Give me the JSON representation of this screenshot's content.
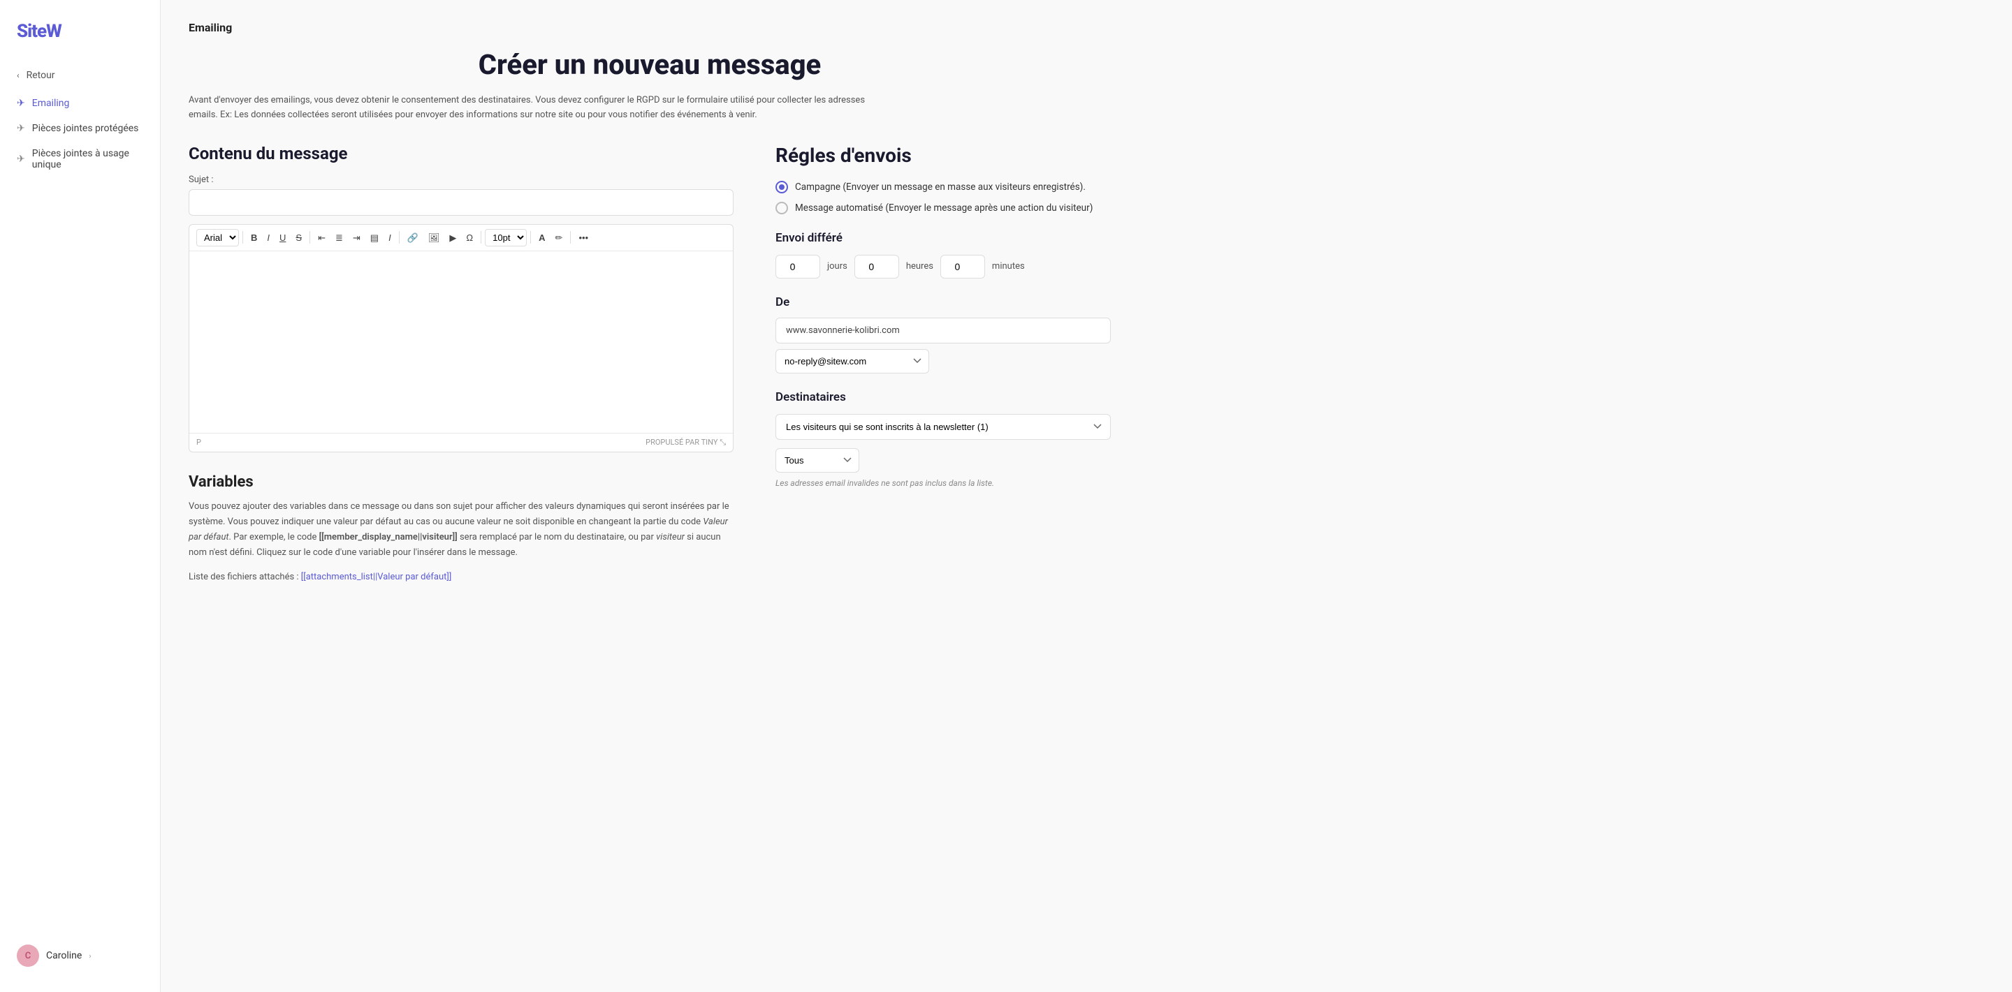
{
  "brand": {
    "logo_text_main": "Site",
    "logo_text_accent": "W"
  },
  "sidebar": {
    "back_label": "Retour",
    "nav_items": [
      {
        "id": "emailing",
        "label": "Emailing",
        "active": true
      },
      {
        "id": "pieces-jointes-protegees",
        "label": "Pièces jointes protégées",
        "active": false
      },
      {
        "id": "pieces-jointes-usage-unique",
        "label": "Pièces jointes à usage unique",
        "active": false
      }
    ],
    "user": {
      "name": "Caroline",
      "avatar_initials": "C"
    }
  },
  "header": {
    "section_title": "Emailing",
    "page_title": "Créer un nouveau message",
    "description": "Avant d'envoyer des emailings, vous devez obtenir le consentement des destinataires. Vous devez configurer le RGPD sur le formulaire utilisé pour collecter les adresses emails. Ex: Les données collectées seront utilisées pour envoyer des informations sur notre site ou pour vous notifier des événements à venir."
  },
  "content": {
    "section_title": "Contenu du message",
    "subject_label": "Sujet :",
    "subject_placeholder": "",
    "toolbar": {
      "font_family": "Arial",
      "font_size": "10pt",
      "bold": "B",
      "italic": "I",
      "underline": "U",
      "strikethrough": "S",
      "align_left": "≡",
      "align_center": "≡",
      "align_right": "≡",
      "justify": "≡",
      "italic2": "I",
      "more": "..."
    },
    "editor_footer_left": "P",
    "editor_footer_right": "PROPULSÉ PAR TINY"
  },
  "variables": {
    "section_title": "Variables",
    "description_parts": {
      "text1": "Vous pouvez ajouter des variables dans ce message ou dans son sujet pour afficher des valeurs dynamiques qui seront insérées par le système. Vous pouvez indiquer une valeur par défaut au cas ou aucune valeur ne soit disponible en changeant la partie du code ",
      "italic": "Valeur par défaut",
      "text2": ". Par exemple, le code ",
      "code": "[[member_display_name||visiteur]]",
      "text3": " sera remplacé par le nom du destinataire, ou par ",
      "italic2": "visiteur",
      "text4": " si aucun nom n'est défini. Cliquez sur le code d'une variable pour l'insérer dans le message."
    },
    "attachments_label": "Liste des fichiers attachés :",
    "attachments_link": "[[attachments_list||Valeur par défaut]]"
  },
  "rules": {
    "section_title": "Régles d'envois",
    "options": [
      {
        "id": "campagne",
        "label": "Campagne (Envoyer un message en masse aux visiteurs enregistrés).",
        "checked": true
      },
      {
        "id": "automatise",
        "label": "Message automatisé (Envoyer le message après une action du visiteur)",
        "checked": false
      }
    ],
    "deferred": {
      "title": "Envoi différé",
      "days_value": "0",
      "days_label": "jours",
      "hours_value": "0",
      "hours_label": "heures",
      "minutes_value": "0",
      "minutes_label": "minutes"
    },
    "from": {
      "title": "De",
      "domain": "www.savonnerie-kolibri.com",
      "email_select_value": "no-reply@sitew.com",
      "email_options": [
        "no-reply@sitew.com"
      ]
    },
    "recipients": {
      "title": "Destinataires",
      "select_value": "Les visiteurs qui se sont inscrits à la newsletter (1)",
      "select_options": [
        "Les visiteurs qui se sont inscrits à la newsletter (1)"
      ],
      "filter_value": "Tous",
      "filter_options": [
        "Tous"
      ],
      "invalid_note": "Les adresses email invalides ne sont pas inclus dans la liste."
    }
  }
}
